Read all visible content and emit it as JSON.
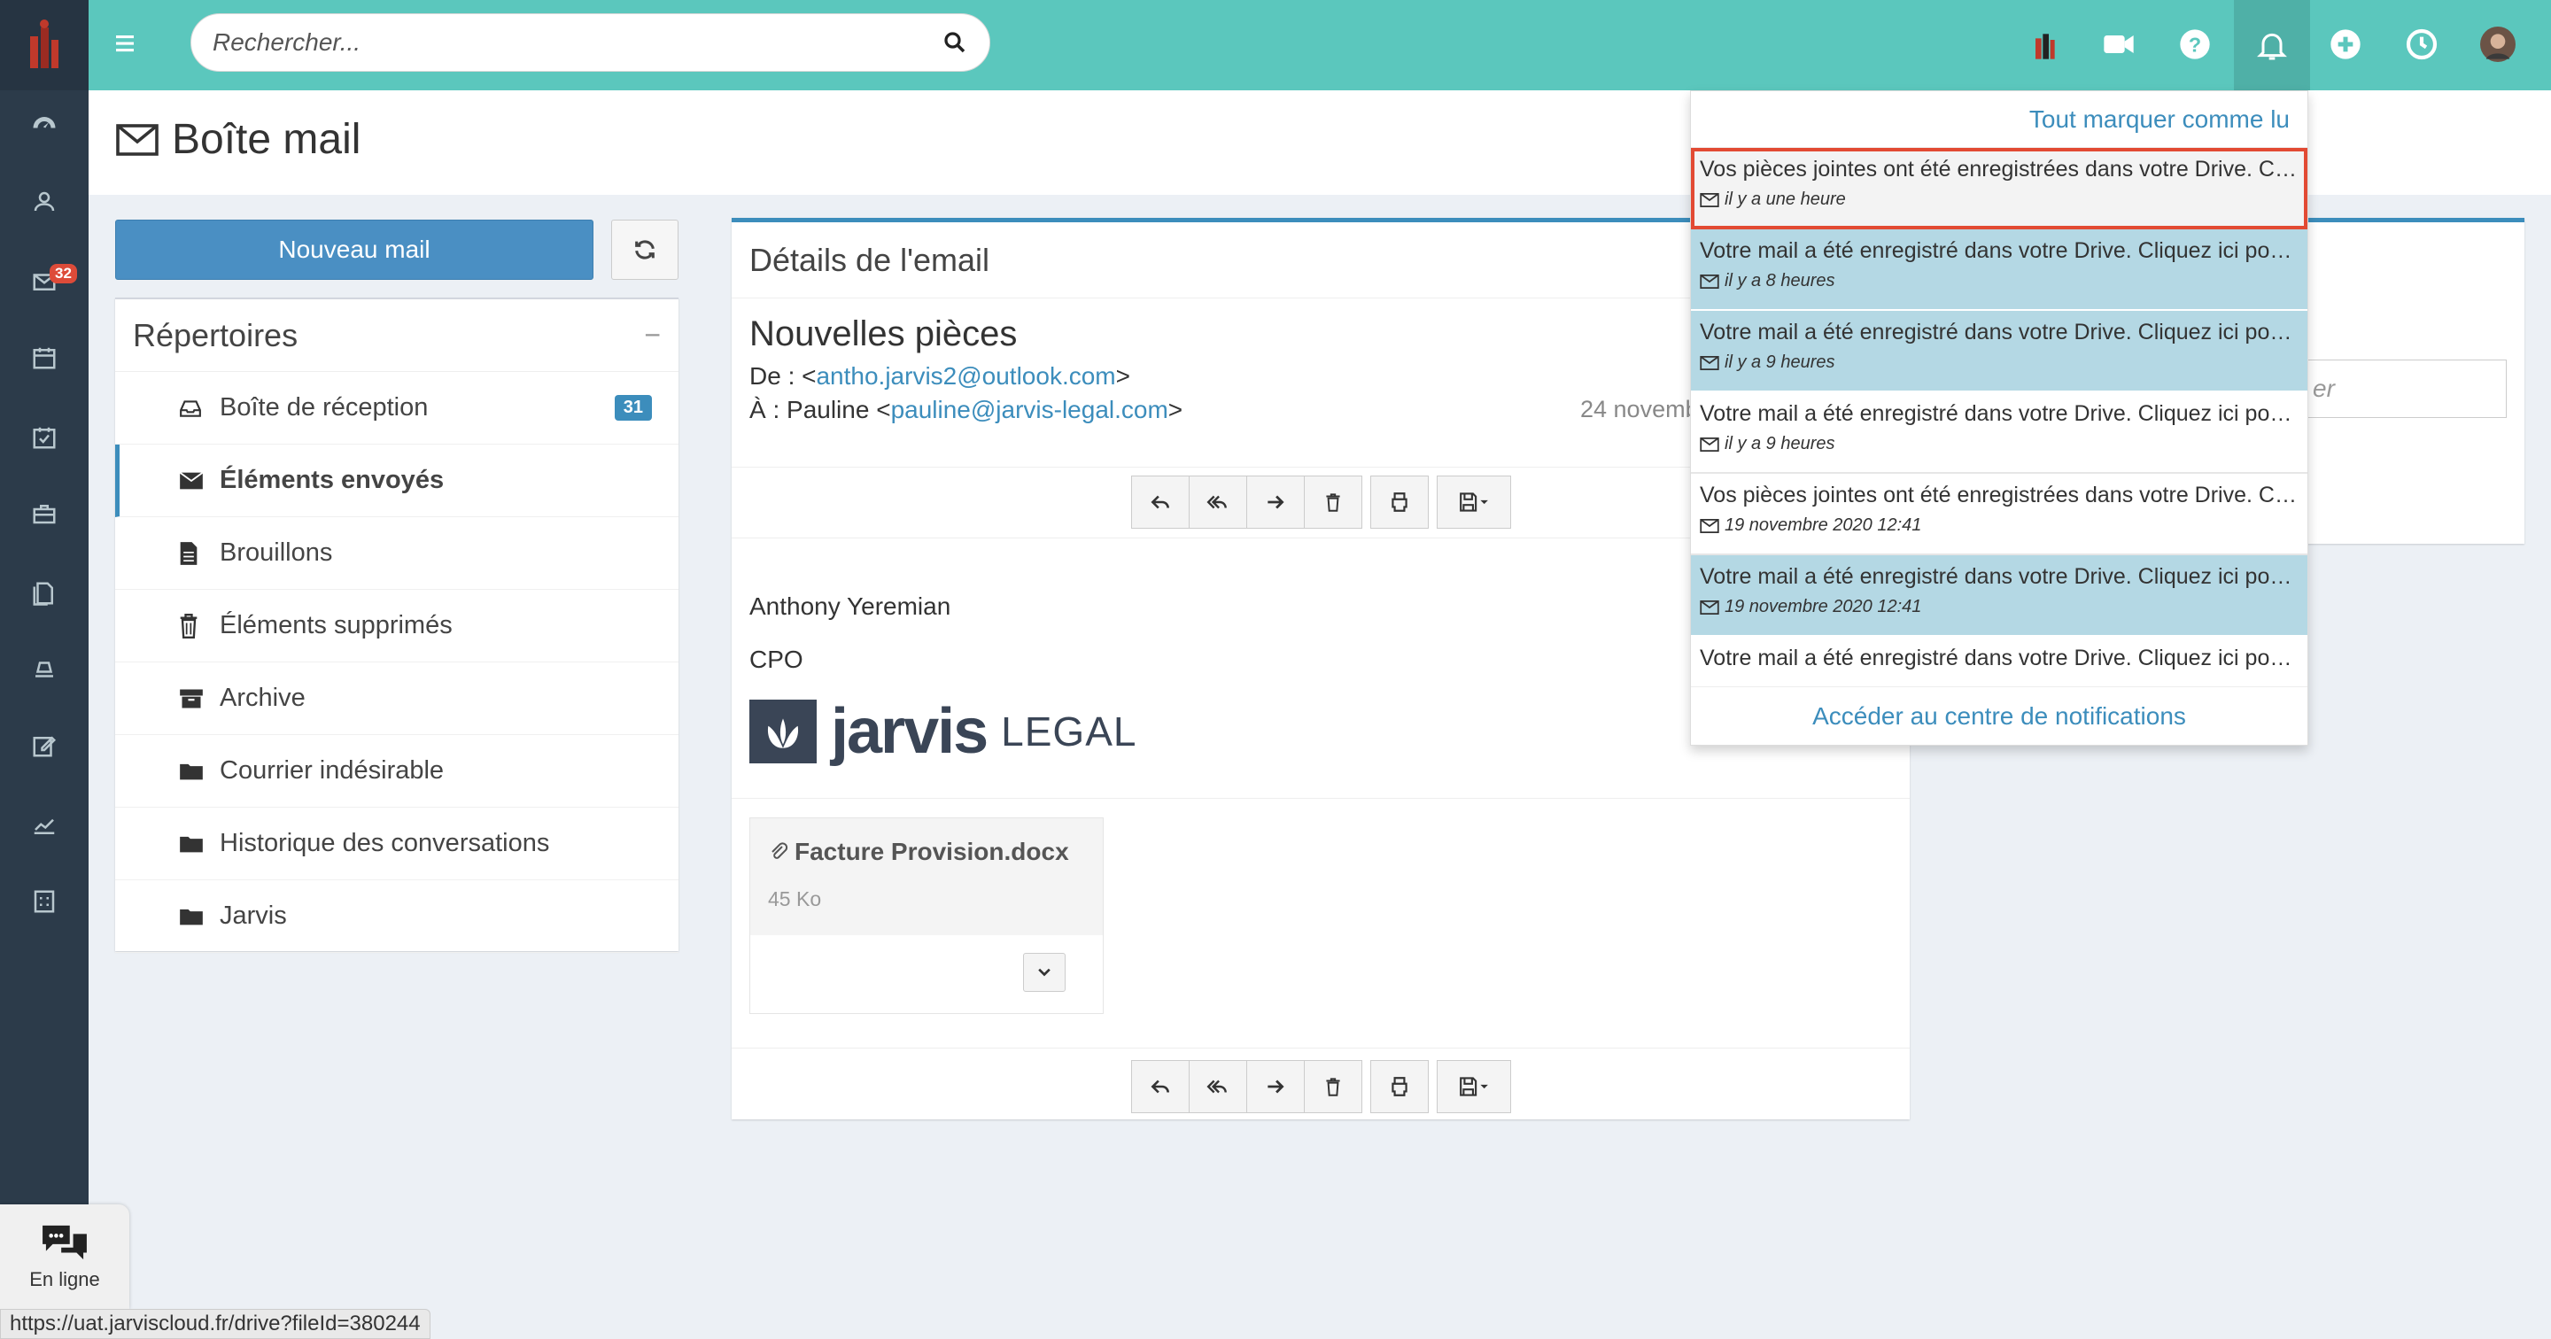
{
  "search": {
    "placeholder": "Rechercher..."
  },
  "sidebar": {
    "mail_badge": "32"
  },
  "page": {
    "title": "Boîte mail"
  },
  "actions": {
    "new_mail": "Nouveau mail"
  },
  "folders": {
    "title": "Répertoires",
    "collapse": "−",
    "items": [
      {
        "label": "Boîte de réception",
        "badge": "31",
        "icon": "inbox-icon"
      },
      {
        "label": "Éléments envoyés",
        "icon": "envelope-icon",
        "active": true
      },
      {
        "label": "Brouillons",
        "icon": "file-icon"
      },
      {
        "label": "Éléments supprimés",
        "icon": "trash-icon"
      },
      {
        "label": "Archive",
        "icon": "archive-icon"
      },
      {
        "label": "Courrier indésirable",
        "icon": "folder-icon"
      },
      {
        "label": "Historique des conversations",
        "icon": "folder-icon"
      },
      {
        "label": "Jarvis",
        "icon": "folder-icon"
      }
    ]
  },
  "email": {
    "panel_title": "Détails de l'email",
    "subject": "Nouvelles pièces",
    "from_label": "De : <",
    "from_email": "antho.jarvis2@outlook.com",
    "from_end": ">",
    "to_label": "À : Pauline <",
    "to_email": "pauline@jarvis-legal.com",
    "to_end": ">",
    "date": "24 novemb",
    "signature_name": "Anthony Yeremian",
    "signature_role": "CPO",
    "logo_main": "jarvis",
    "logo_sub": "LEGAL",
    "attachment": {
      "name": "Facture Provision.docx",
      "size": "45 Ko"
    }
  },
  "right_panel": {
    "input_fragment": "er"
  },
  "notifications": {
    "mark_all": "Tout marquer comme lu",
    "footer": "Accéder au centre de notifications",
    "items": [
      {
        "text": "Vos pièces jointes ont été enregistrées dans votre Drive. Cliquez ici pour y accéder",
        "time": "il y a une heure",
        "state": "selected"
      },
      {
        "text": "Votre mail a été enregistré dans votre Drive. Cliquez ici pour y accéder",
        "time": "il y a 8 heures",
        "state": "unread"
      },
      {
        "text": "Votre mail a été enregistré dans votre Drive. Cliquez ici pour y accéder",
        "time": "il y a 9 heures",
        "state": "unread"
      },
      {
        "text": "Votre mail a été enregistré dans votre Drive. Cliquez ici pour y accéder",
        "time": "il y a 9 heures",
        "state": "read"
      },
      {
        "text": "Vos pièces jointes ont été enregistrées dans votre Drive. Cliquez ici pour y accéder",
        "time": "19 novembre 2020 12:41",
        "state": "read"
      },
      {
        "text": "Votre mail a été enregistré dans votre Drive. Cliquez ici pour y accéder",
        "time": "19 novembre 2020 12:41",
        "state": "unread"
      },
      {
        "text": "Votre mail a été enregistré dans votre Drive. Cliquez ici pour y accéder",
        "time": "",
        "state": "read"
      }
    ]
  },
  "chat": {
    "label": "En ligne"
  },
  "status_url": "https://uat.jarviscloud.fr/drive?fileId=380244",
  "colors": {
    "topbar": "#5bc7bd",
    "sidebar": "#2c3b4a",
    "accent": "#3c8dbc",
    "highlight": "#e24a33",
    "unread": "#b4d8e4"
  }
}
